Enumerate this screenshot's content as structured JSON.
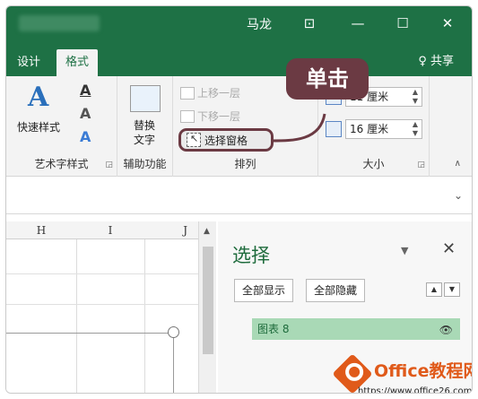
{
  "titlebar": {
    "user": "马龙",
    "controls": [
      "⊡",
      "—",
      "☐",
      "✕"
    ]
  },
  "tabs": [
    {
      "label": "设计",
      "active": false
    },
    {
      "label": "格式",
      "active": true
    }
  ],
  "share_label": "♀ 共享",
  "ribbon": {
    "art_group": {
      "quick_styles_label": "快速样式",
      "group_label": "艺术字样式"
    },
    "alt_group": {
      "label_line1": "替换",
      "label_line2": "文字",
      "group_label": "辅助功能"
    },
    "arrange_group": {
      "bring_forward": "上移一层",
      "send_backward": "下移一层",
      "selection_pane": "选择窗格",
      "group_label": "排列"
    },
    "size_group": {
      "height_value": "11 厘米",
      "width_value": "16 厘米",
      "group_label": "大小"
    }
  },
  "callout_label": "单击",
  "grid": {
    "columns": [
      "H",
      "I",
      "J"
    ]
  },
  "selection_pane": {
    "title": "选择",
    "show_all": "全部显示",
    "hide_all": "全部隐藏",
    "item": "图表 8"
  },
  "watermark": {
    "title": "Office教程网",
    "url": "https://www.office26.com"
  }
}
